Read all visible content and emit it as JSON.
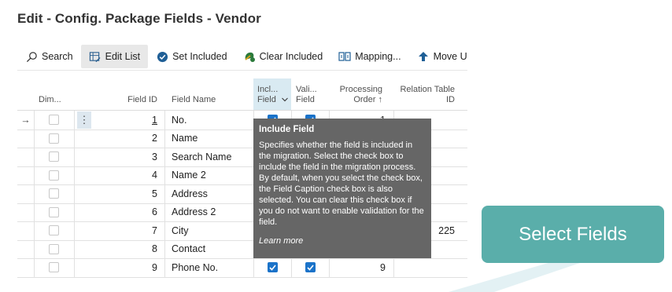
{
  "page": {
    "title": "Edit - Config. Package Fields - Vendor"
  },
  "toolbar": {
    "items": [
      {
        "label": "Search",
        "icon": "search-icon"
      },
      {
        "label": "Edit List",
        "icon": "edit-list-icon"
      },
      {
        "label": "Set Included",
        "icon": "check-circle-icon"
      },
      {
        "label": "Clear Included",
        "icon": "clear-icon"
      },
      {
        "label": "Mapping...",
        "icon": "mapping-icon"
      },
      {
        "label": "Move Up",
        "icon": "arrow-up-icon"
      }
    ]
  },
  "table": {
    "headers": {
      "dim": "Dim...",
      "field_id": "Field ID",
      "field_name": "Field Name",
      "incl_line1": "Incl...",
      "incl_line2": "Field",
      "vali_line1": "Vali...",
      "vali_line2": "Field",
      "proc_line1": "Processing",
      "proc_line2": "Order ↑",
      "rel_line1": "Relation Table",
      "rel_line2": "ID"
    },
    "row_marker": "→",
    "row_menu": "⋮",
    "rows": [
      {
        "field_id": "1",
        "field_name": "No.",
        "processing_order": "1",
        "relation_table_id": ""
      },
      {
        "field_id": "2",
        "field_name": "Name",
        "processing_order": "",
        "relation_table_id": ""
      },
      {
        "field_id": "3",
        "field_name": "Search Name",
        "processing_order": "",
        "relation_table_id": ""
      },
      {
        "field_id": "4",
        "field_name": "Name 2",
        "processing_order": "",
        "relation_table_id": ""
      },
      {
        "field_id": "5",
        "field_name": "Address",
        "processing_order": "",
        "relation_table_id": ""
      },
      {
        "field_id": "6",
        "field_name": "Address 2",
        "processing_order": "",
        "relation_table_id": ""
      },
      {
        "field_id": "7",
        "field_name": "City",
        "processing_order": "",
        "relation_table_id": "225"
      },
      {
        "field_id": "8",
        "field_name": "Contact",
        "processing_order": "",
        "relation_table_id": ""
      },
      {
        "field_id": "9",
        "field_name": "Phone No.",
        "processing_order": "9",
        "relation_table_id": ""
      }
    ]
  },
  "tooltip": {
    "title": "Include Field",
    "body": "Specifies whether the field is included in the migration. Select the check box to include the field in the migration process. By default, when you select the check box, the Field Caption check box is also selected. You can clear this check box if you do not want to enable validation for the field.",
    "link": "Learn more"
  },
  "callout": {
    "text": "Select Fields"
  },
  "colors": {
    "callout": "#5aaeaa",
    "tooltip": "#666666",
    "checkbox_checked": "#1b73c9",
    "header_highlight": "#d9eaf2"
  }
}
